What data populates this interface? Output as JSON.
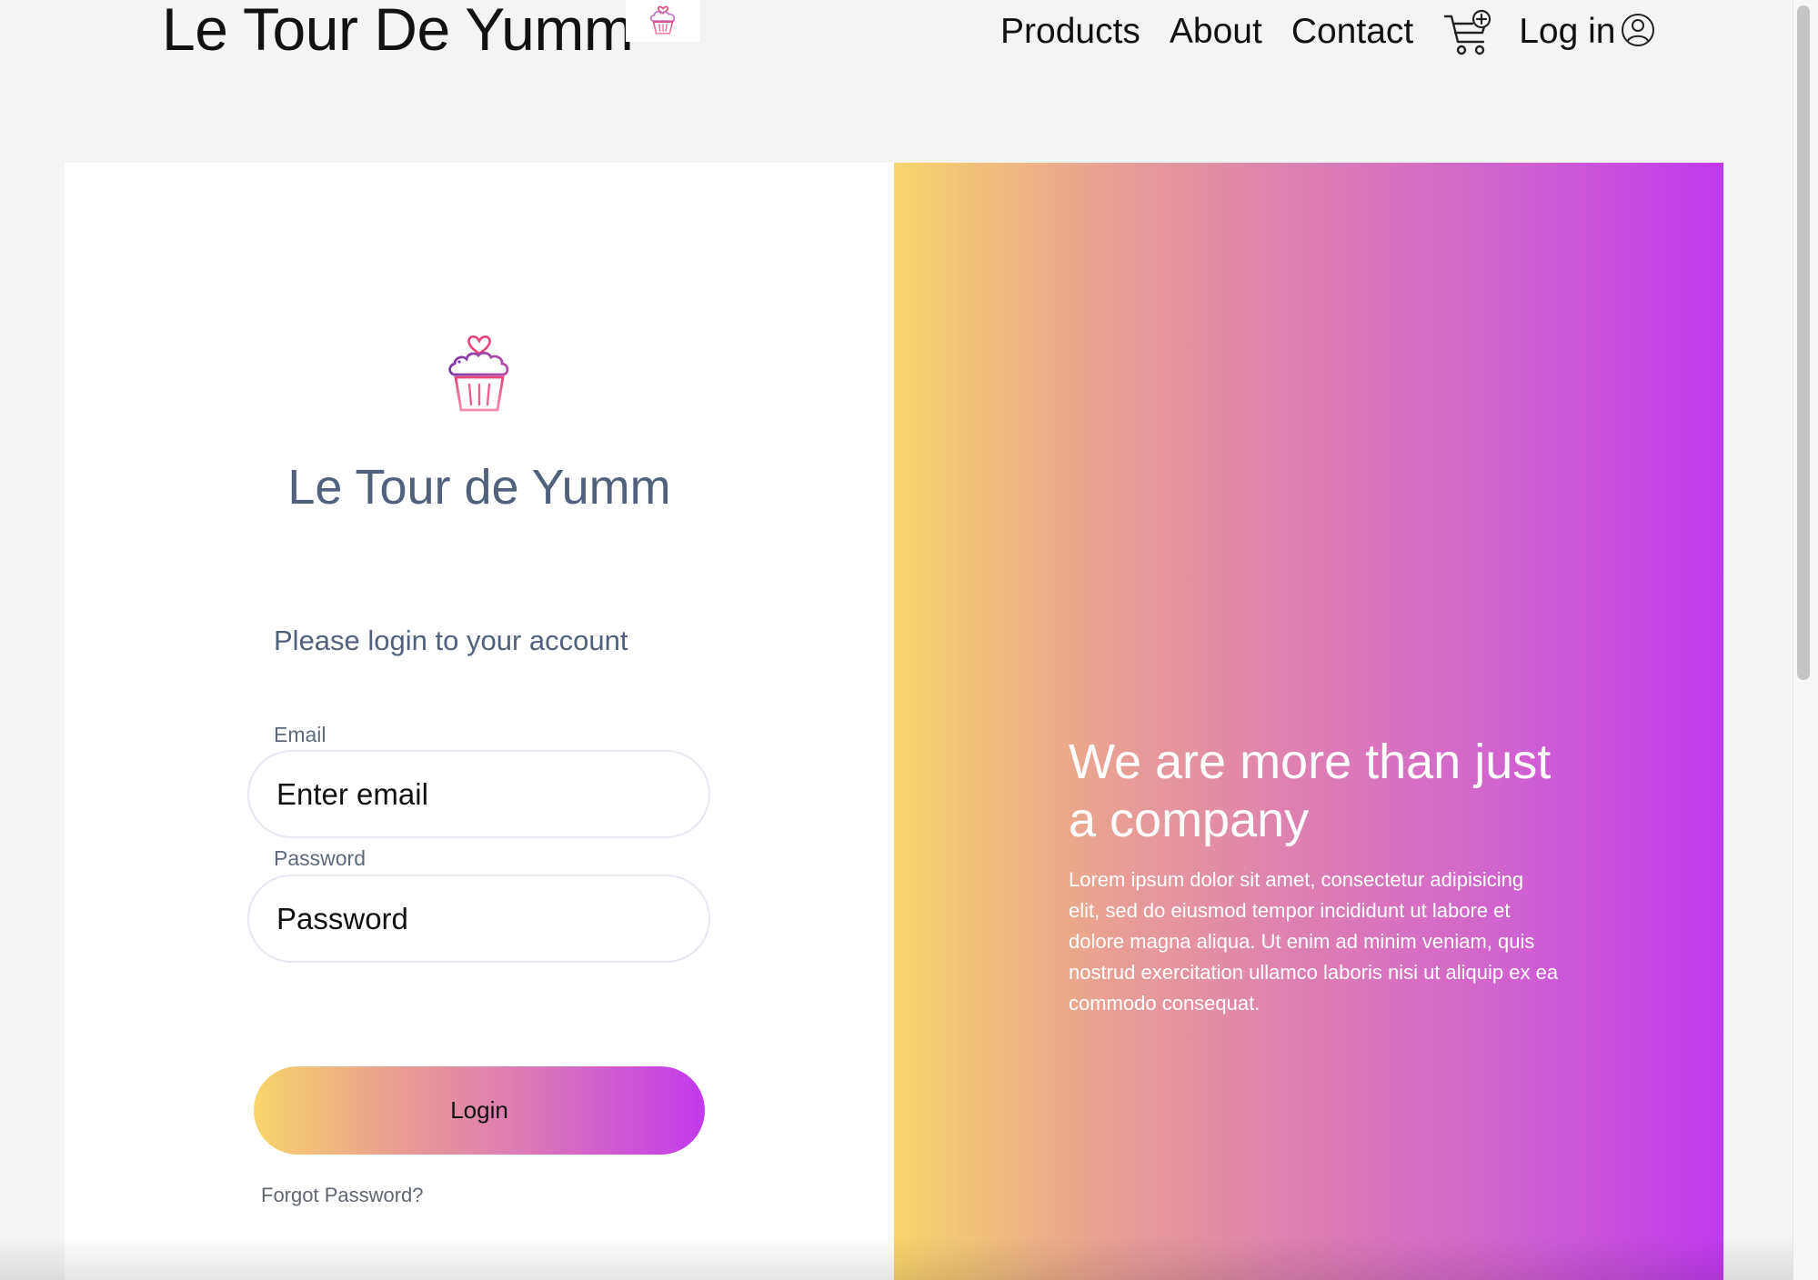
{
  "navbar": {
    "brand_name": "Le Tour De Yumm",
    "links": {
      "products": "Products",
      "about": "About",
      "contact": "Contact",
      "login": "Log in"
    }
  },
  "login_panel": {
    "title": "Le Tour de Yumm",
    "subtitle": "Please login to your account",
    "email_label": "Email",
    "email_placeholder": "Enter email",
    "password_label": "Password",
    "password_placeholder": "Password",
    "login_button": "Login",
    "forgot_password": "Forgot Password?"
  },
  "promo_panel": {
    "heading": "We are more than just a company",
    "text": "Lorem ipsum dolor sit amet, consectetur adipisicing elit, sed do eiusmod tempor incididunt ut labore et dolore magna aliqua. Ut enim ad minim veniam, quis nostrud exercitation ullamco laboris nisi ut aliquip ex ea commodo consequat."
  },
  "icons": {
    "brand_logo": "cupcake-icon",
    "cart": "cart-plus-icon",
    "user": "user-circle-icon",
    "panel_logo": "cupcake-icon"
  },
  "colors": {
    "gradient_start": "#f8d56b",
    "gradient_mid": "#dc7eb3",
    "gradient_end": "#c139ec",
    "title_text": "#51607c"
  }
}
